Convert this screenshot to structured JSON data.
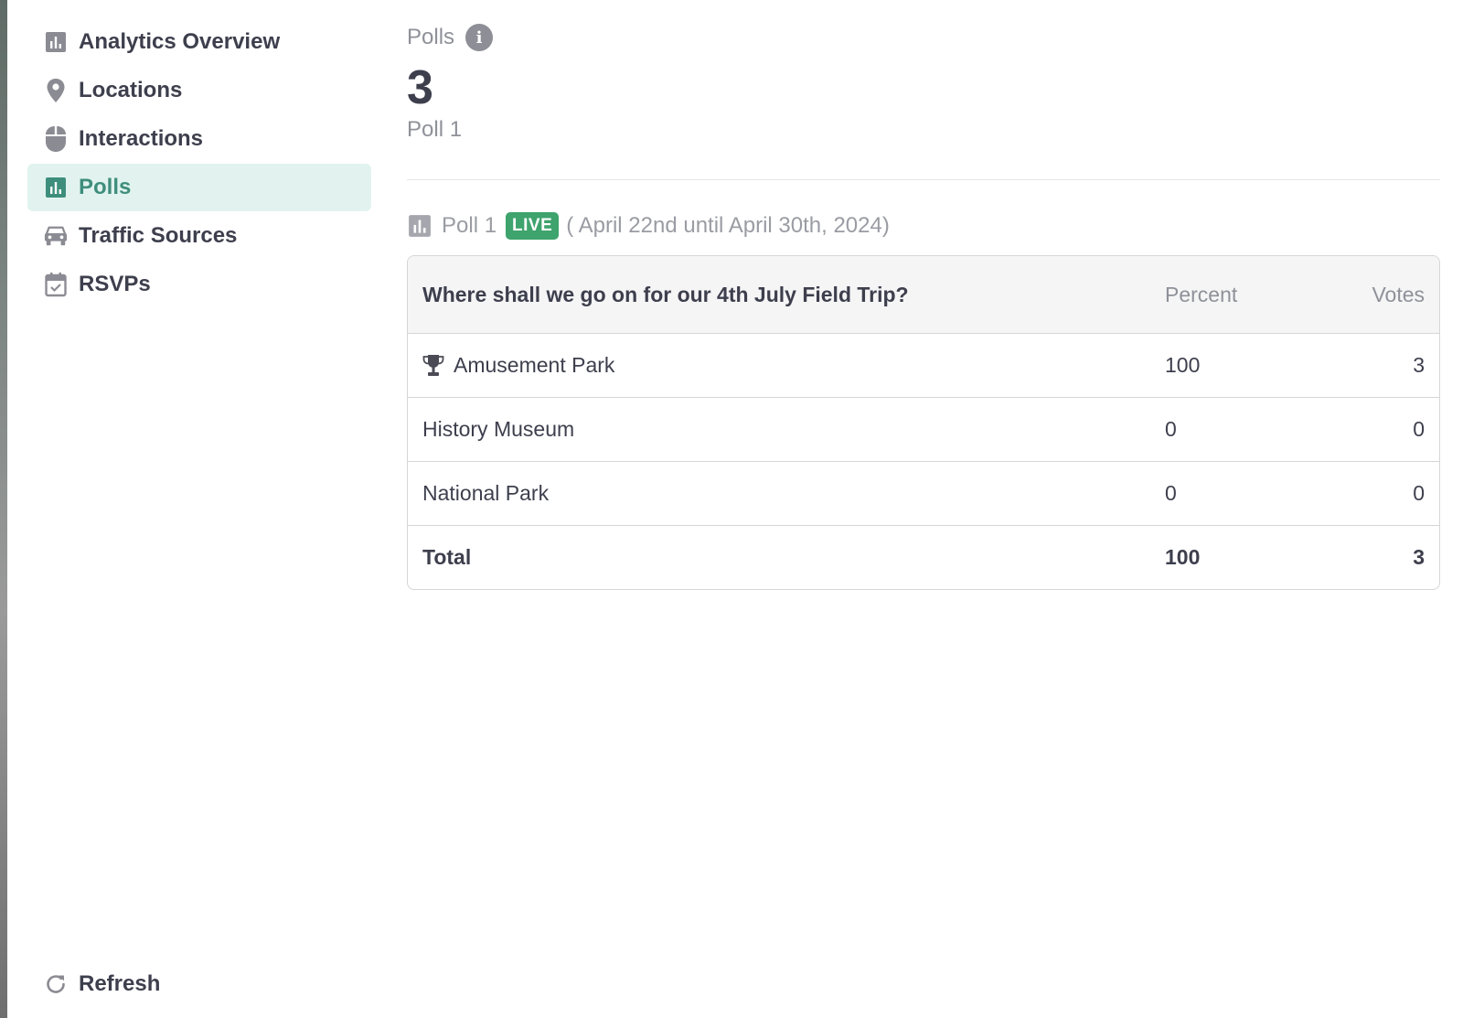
{
  "sidebar": {
    "items": [
      {
        "label": "Analytics Overview",
        "icon": "bar-chart-icon",
        "active": false
      },
      {
        "label": "Locations",
        "icon": "map-pin-icon",
        "active": false
      },
      {
        "label": "Interactions",
        "icon": "mouse-icon",
        "active": false
      },
      {
        "label": "Polls",
        "icon": "bar-chart-icon",
        "active": true
      },
      {
        "label": "Traffic Sources",
        "icon": "car-icon",
        "active": false
      },
      {
        "label": "RSVPs",
        "icon": "calendar-check-icon",
        "active": false
      }
    ],
    "refresh_label": "Refresh"
  },
  "main": {
    "heading": "Polls",
    "count": "3",
    "sub_label": "Poll 1",
    "poll": {
      "name": "Poll 1",
      "badge": "LIVE",
      "date_range": "( April 22nd until April 30th, 2024)",
      "question": "Where shall we go on for our 4th July Field Trip?",
      "columns": {
        "percent": "Percent",
        "votes": "Votes"
      },
      "options": [
        {
          "label": "Amusement Park",
          "percent": "100",
          "votes": "3",
          "winner": true
        },
        {
          "label": "History Museum",
          "percent": "0",
          "votes": "0",
          "winner": false
        },
        {
          "label": "National Park",
          "percent": "0",
          "votes": "0",
          "winner": false
        }
      ],
      "total": {
        "label": "Total",
        "percent": "100",
        "votes": "3"
      }
    }
  },
  "colors": {
    "accent": "#3e8e7c",
    "active_bg": "#e2f3ef",
    "live_badge": "#3fa36d",
    "text": "#3d3f4d",
    "muted": "#8f9199"
  }
}
